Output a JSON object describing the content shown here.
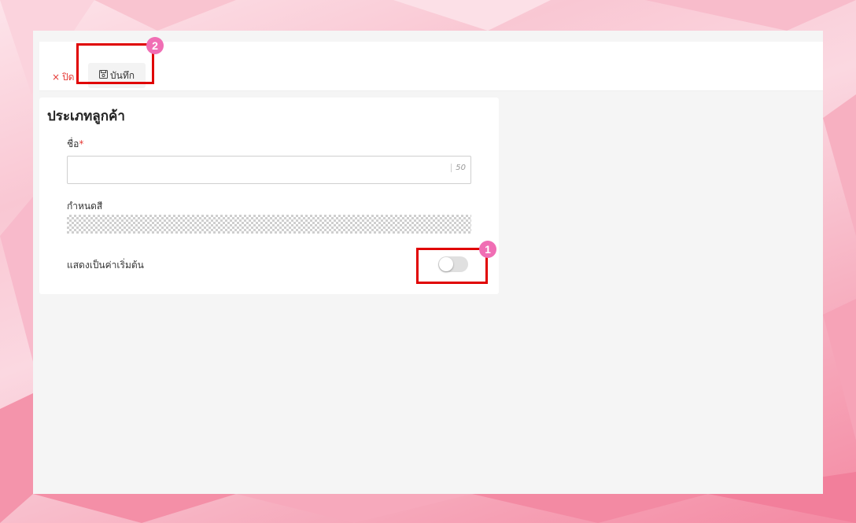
{
  "toolbar": {
    "close_icon": "×",
    "close_label": "ปิด",
    "save_icon": "save-icon",
    "save_label": "บันทึก"
  },
  "form": {
    "title": "ประเภทลูกค้า",
    "name_field": {
      "label": "ชื่อ",
      "required_mark": "*",
      "value": "",
      "max_length": "50"
    },
    "color_field": {
      "label": "กำหนดสี"
    },
    "default_toggle": {
      "label": "แสดงเป็นค่าเริ่มต้น",
      "checked": false
    }
  },
  "annotations": [
    {
      "number": "1",
      "color": "#f06eb4"
    },
    {
      "number": "2",
      "color": "#f06eb4"
    }
  ],
  "colors": {
    "accent_red": "#e53935",
    "highlight_box": "#e00000"
  }
}
